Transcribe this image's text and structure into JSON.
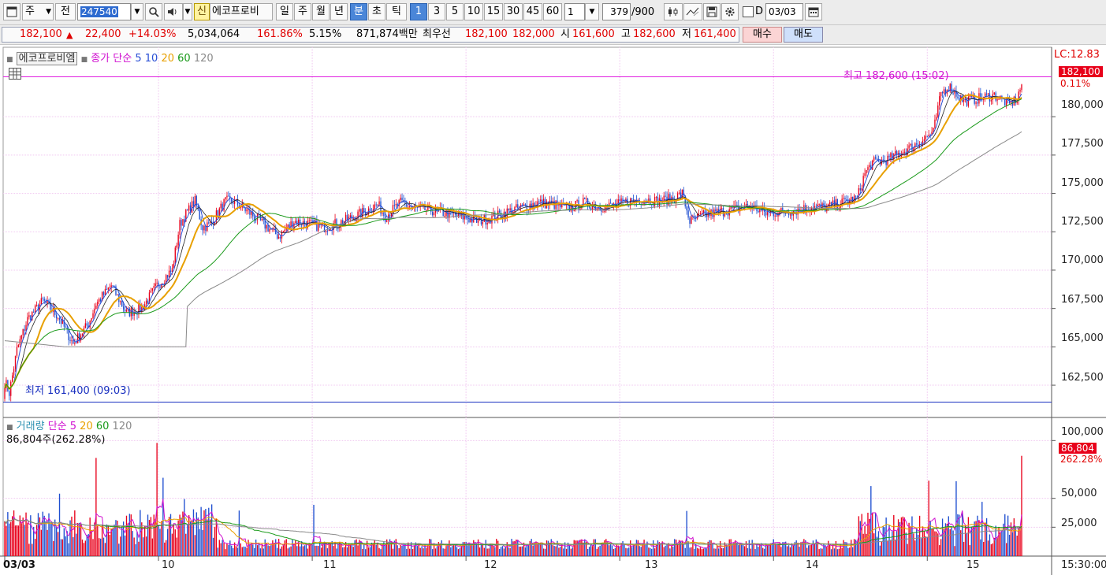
{
  "toolbar": {
    "market_type": "주",
    "prev_label": "전",
    "code": "247540",
    "new_badge": "신",
    "stock_name": "에코프로비",
    "periods": [
      "일",
      "주",
      "월",
      "년",
      "분",
      "초",
      "틱"
    ],
    "minute_options": [
      "1",
      "3",
      "5",
      "10",
      "15",
      "30",
      "45",
      "60"
    ],
    "interval_value": "1",
    "count_value": "379",
    "count_total": "/900",
    "date_label": "D",
    "date_value": "03/03"
  },
  "quote": {
    "price": "182,100",
    "change": "22,400",
    "change_pct": "+14.03%",
    "volume": "5,034,064",
    "volume_ratio": "161.86%",
    "turnover": "5.15%",
    "trade_value": "871,874백만",
    "best_label": "최우선",
    "best_sell": "182,100",
    "best_buy": "182,000",
    "open_label": "시",
    "open_value": "161,600",
    "high_label": "고",
    "high_value": "182,600",
    "low_label": "저",
    "low_value": "161,400",
    "buy_button": "매수",
    "sell_button": "매도"
  },
  "price_pane": {
    "title": "에코프로비엠",
    "ma_label": "종가 단순",
    "ma_periods": [
      "5",
      "10",
      "20",
      "60",
      "120"
    ],
    "high_note": "최고 182,600 (15:02)",
    "low_note": "최저 161,400 (09:03)",
    "lc_label": "LC:12.83",
    "price_tag": "182,100",
    "pct_tag": "0.11%",
    "y_ticks": [
      "180,000",
      "177,500",
      "175,000",
      "172,500",
      "170,000",
      "167,500",
      "165,000",
      "162,500"
    ]
  },
  "volume_pane": {
    "title": "거래량",
    "ma_label": "단순",
    "ma_periods": [
      "5",
      "20",
      "60",
      "120"
    ],
    "current_note": "86,804주(262.28%)",
    "vol_tag": "86,804",
    "pct_tag": "262.28%",
    "y_ticks": [
      "100,000",
      "50,000",
      "25,000"
    ]
  },
  "x_axis": {
    "labels": [
      "03/03",
      "10",
      "11",
      "12",
      "13",
      "14",
      "15"
    ],
    "time_label": "15:30:00"
  },
  "colors": {
    "up": "#e8001a",
    "down": "#1f4fd0",
    "ma5": "#2a4fd6",
    "ma10": "#222222",
    "ma20": "#e8a000",
    "ma60": "#1a9a1a",
    "ma120": "#8a8a8a",
    "vol_ma5": "#d010d0",
    "high_line": "#e020e0",
    "low_line": "#1a30c0",
    "grid": "#f0c8f0"
  },
  "chart_data": {
    "type": "candlestick",
    "x_hours": [
      "09",
      "10",
      "11",
      "12",
      "13",
      "14",
      "15"
    ],
    "price_ylim": [
      160500,
      183500
    ],
    "price_anchors": [
      [
        0,
        162800
      ],
      [
        3,
        162000
      ],
      [
        8,
        164800
      ],
      [
        15,
        166800
      ],
      [
        25,
        168000
      ],
      [
        35,
        167000
      ],
      [
        45,
        165200
      ],
      [
        55,
        166500
      ],
      [
        60,
        167800
      ],
      [
        70,
        169000
      ],
      [
        80,
        167200
      ],
      [
        90,
        167500
      ],
      [
        100,
        169000
      ],
      [
        110,
        170000
      ],
      [
        115,
        173000
      ],
      [
        118,
        173500
      ],
      [
        125,
        174500
      ],
      [
        130,
        172800
      ],
      [
        135,
        173000
      ],
      [
        145,
        174500
      ],
      [
        150,
        174500
      ],
      [
        160,
        173800
      ],
      [
        170,
        173000
      ],
      [
        180,
        172200
      ],
      [
        190,
        173200
      ],
      [
        200,
        173000
      ],
      [
        210,
        172800
      ],
      [
        220,
        173100
      ],
      [
        230,
        173500
      ],
      [
        240,
        174000
      ],
      [
        245,
        174300
      ],
      [
        250,
        173500
      ],
      [
        260,
        174400
      ],
      [
        270,
        174000
      ],
      [
        280,
        173900
      ],
      [
        290,
        173700
      ],
      [
        300,
        173500
      ],
      [
        310,
        173200
      ],
      [
        320,
        173400
      ],
      [
        330,
        173800
      ],
      [
        340,
        174100
      ],
      [
        350,
        174400
      ],
      [
        360,
        174300
      ],
      [
        370,
        174000
      ],
      [
        380,
        174400
      ],
      [
        390,
        174100
      ],
      [
        400,
        174200
      ],
      [
        410,
        174500
      ],
      [
        420,
        174600
      ],
      [
        430,
        174500
      ],
      [
        440,
        174700
      ],
      [
        445,
        175000
      ],
      [
        450,
        173200
      ],
      [
        460,
        173600
      ],
      [
        470,
        173800
      ],
      [
        480,
        174000
      ],
      [
        490,
        174200
      ],
      [
        500,
        173700
      ],
      [
        510,
        173800
      ],
      [
        520,
        173900
      ],
      [
        530,
        174100
      ],
      [
        540,
        174100
      ],
      [
        550,
        174400
      ],
      [
        560,
        174700
      ],
      [
        565,
        176300
      ],
      [
        570,
        177000
      ],
      [
        580,
        177200
      ],
      [
        590,
        177700
      ],
      [
        600,
        178300
      ],
      [
        610,
        179000
      ],
      [
        615,
        181500
      ],
      [
        620,
        182000
      ],
      [
        630,
        181000
      ],
      [
        640,
        181200
      ],
      [
        650,
        181400
      ],
      [
        660,
        180800
      ],
      [
        665,
        181200
      ],
      [
        668,
        182100
      ]
    ],
    "vol_ylim": [
      0,
      105000
    ],
    "total_minutes": 668,
    "minutes_per_day_col": [
      0,
      101,
      202,
      303,
      404,
      505,
      606
    ]
  }
}
